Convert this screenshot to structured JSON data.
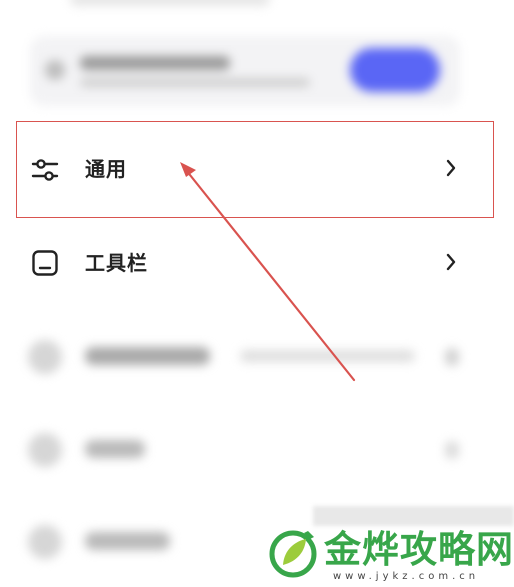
{
  "menu": {
    "general": {
      "label": "通用",
      "icon": "sliders-icon"
    },
    "toolbar": {
      "label": "工具栏",
      "icon": "toolbar-icon"
    }
  },
  "watermark": {
    "brand": "金烨攻略网",
    "url": "www.jykz.com.cn"
  },
  "colors": {
    "highlight": "#d9534f",
    "account_button": "#5a66f5",
    "watermark_green": "#38a64a"
  }
}
